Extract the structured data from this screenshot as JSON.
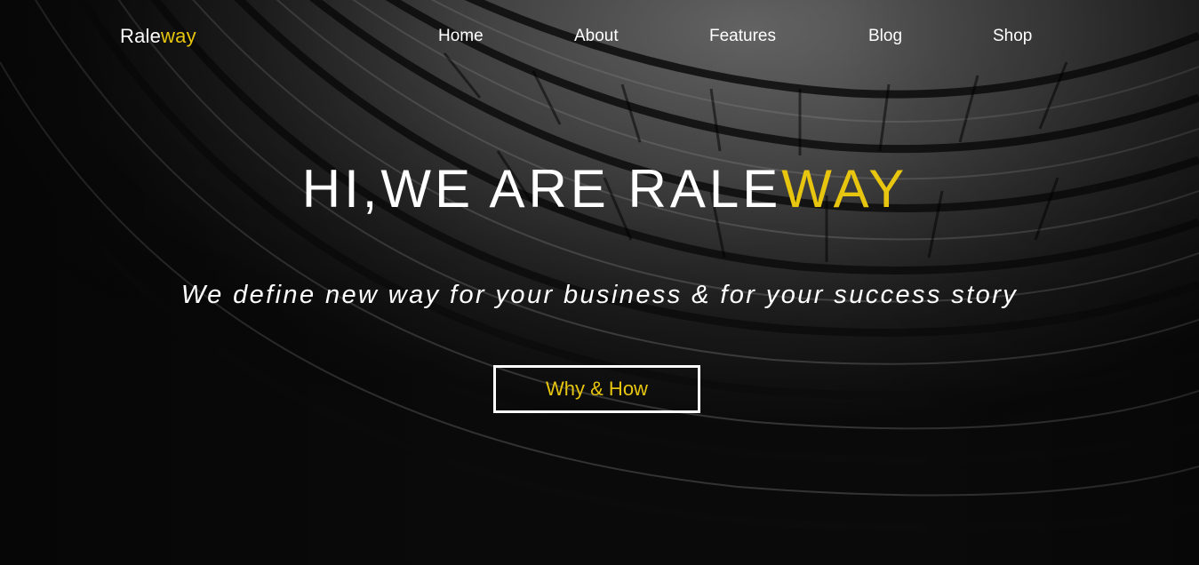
{
  "brand": {
    "part1": "Rale",
    "part2": "way"
  },
  "nav": [
    {
      "label": "Home"
    },
    {
      "label": "About"
    },
    {
      "label": "Features"
    },
    {
      "label": "Blog"
    },
    {
      "label": "Shop"
    }
  ],
  "hero": {
    "headline_main": "HI,WE ARE RALE",
    "headline_accent": "WAY",
    "subheadline": "We define new way for your business & for your success story",
    "cta_label": "Why & How"
  },
  "colors": {
    "accent": "#e8c60f",
    "text": "#ffffff",
    "background": "#0a0a0a"
  }
}
